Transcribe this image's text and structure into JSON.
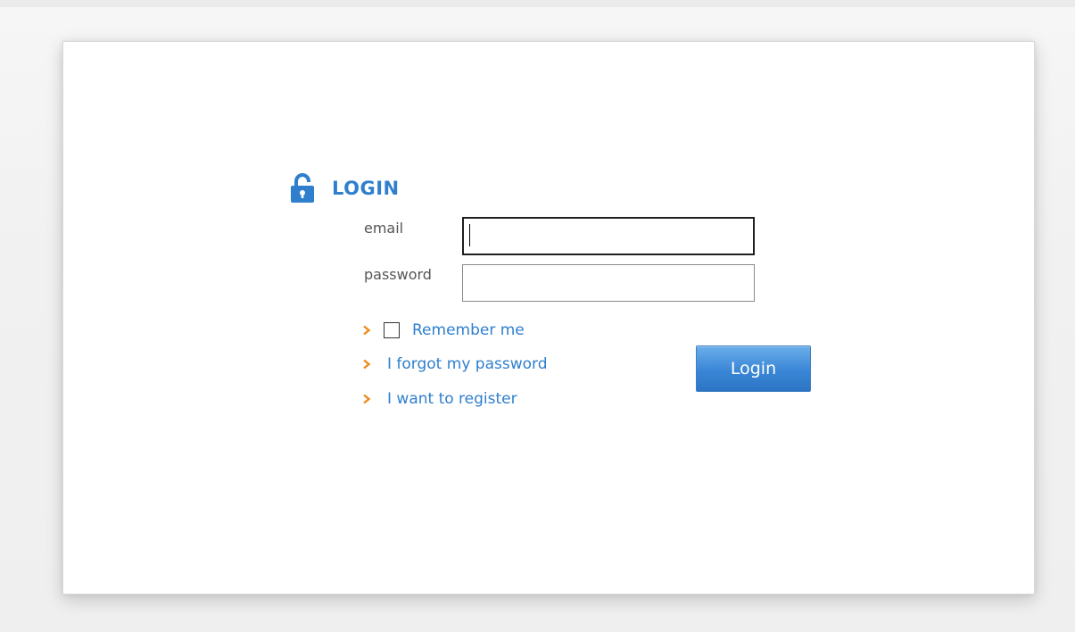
{
  "login": {
    "title": "LOGIN",
    "email_label": "email",
    "email_value": "",
    "password_label": "password",
    "password_value": "",
    "remember_label": "Remember me",
    "remember_checked": false,
    "forgot_link": "I forgot my password",
    "register_link": "I want to register",
    "submit_label": "Login"
  },
  "icons": {
    "lock": "lock-icon",
    "chevron": "chevron-right-icon"
  },
  "colors": {
    "accent": "#2f7fcd",
    "chevron": "#f08a1c",
    "button_top": "#6aaeea",
    "button_bottom": "#2d75c4"
  }
}
